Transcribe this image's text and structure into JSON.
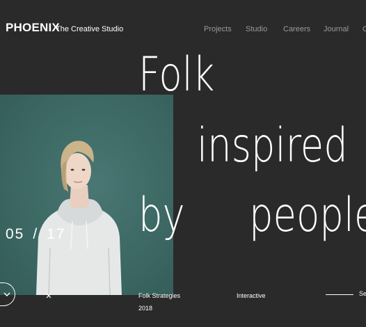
{
  "header": {
    "logo": "PHOENIX",
    "tagline": "The Creative Studio",
    "nav": [
      "Projects",
      "Studio",
      "Careers",
      "Journal",
      "C"
    ]
  },
  "hero": {
    "headline_words": [
      "Folk",
      "inspired",
      "by",
      "people"
    ],
    "counter_current": "05",
    "counter_separator": "/",
    "counter_total": "17",
    "photo_icon": "portrait-photo",
    "photo_bg_color": "#3f6b67"
  },
  "project": {
    "name": "Folk Strategies",
    "year": "2018",
    "category": "Interactive",
    "see_label": "See"
  },
  "icons": {
    "scroll": "chevron-down-icon",
    "close": "close-icon"
  },
  "colors": {
    "background": "#2a2a2a",
    "text": "#ffffff",
    "nav_text": "#9a9a9a",
    "photo_bg": "#3f6b67"
  }
}
